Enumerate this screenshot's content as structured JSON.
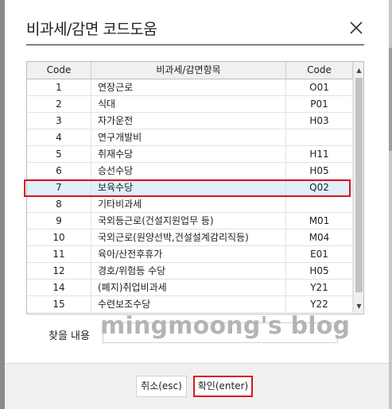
{
  "dialog": {
    "title": "비과세/감면 코드도움"
  },
  "table": {
    "headers": [
      "Code",
      "비과세/감면항목",
      "Code"
    ],
    "rows": [
      {
        "code": "1",
        "name": "연장근로",
        "code2": "O01"
      },
      {
        "code": "2",
        "name": "식대",
        "code2": "P01"
      },
      {
        "code": "3",
        "name": "자가운전",
        "code2": "H03"
      },
      {
        "code": "4",
        "name": "연구개발비",
        "code2": ""
      },
      {
        "code": "5",
        "name": "취재수당",
        "code2": "H11"
      },
      {
        "code": "6",
        "name": "승선수당",
        "code2": "H05"
      },
      {
        "code": "7",
        "name": "보육수당",
        "code2": "Q02"
      },
      {
        "code": "8",
        "name": "기타비과세",
        "code2": ""
      },
      {
        "code": "9",
        "name": "국외등근로(건설지원업무 등)",
        "code2": "M01"
      },
      {
        "code": "10",
        "name": "국외근로(원양선박,건설설계감리직등)",
        "code2": "M04"
      },
      {
        "code": "11",
        "name": "육아/산전후휴가",
        "code2": "E01"
      },
      {
        "code": "12",
        "name": "경호/위험등 수당",
        "code2": "H05"
      },
      {
        "code": "14",
        "name": "(폐지)취업비과세",
        "code2": "Y21"
      },
      {
        "code": "15",
        "name": "수련보조수당",
        "code2": "Y22"
      }
    ],
    "selected_index": 6
  },
  "search": {
    "label": "찾을 내용",
    "value": "",
    "watermark": "mingmoong's blog"
  },
  "buttons": {
    "cancel": "취소(esc)",
    "ok": "확인(enter)"
  },
  "colors": {
    "highlight": "#d9141f",
    "selected_row": "#dff0fb"
  }
}
